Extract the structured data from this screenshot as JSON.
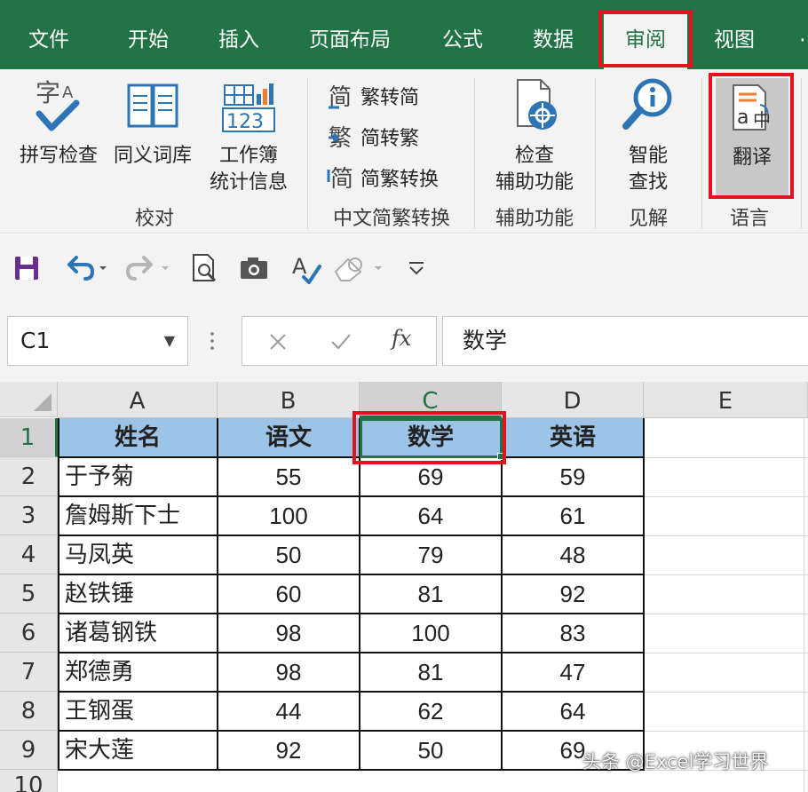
{
  "tabs": [
    {
      "label": "文件",
      "active": false
    },
    {
      "label": "开始",
      "active": false
    },
    {
      "label": "插入",
      "active": false
    },
    {
      "label": "页面布局",
      "active": false
    },
    {
      "label": "公式",
      "active": false
    },
    {
      "label": "数据",
      "active": false
    },
    {
      "label": "审阅",
      "active": true
    },
    {
      "label": "视图",
      "active": false
    }
  ],
  "ribbon": {
    "proofing": {
      "spell_check": "拼写检查",
      "thesaurus": "同义词库",
      "workbook_stats_line1": "工作簿",
      "workbook_stats_line2": "统计信息",
      "group_label": "校对"
    },
    "chinese_conversion": {
      "to_simplified": "繁转简",
      "to_traditional": "简转繁",
      "convert": "简繁转换",
      "group_label": "中文简繁转换"
    },
    "accessibility": {
      "check_line1": "检查",
      "check_line2": "辅助功能",
      "group_label": "辅助功能"
    },
    "insights": {
      "smart_lookup_line1": "智能",
      "smart_lookup_line2": "查找",
      "group_label": "见解"
    },
    "language": {
      "translate": "翻译",
      "group_label": "语言"
    }
  },
  "formula_bar": {
    "name_box": "C1",
    "formula": "数学",
    "fx_symbol": "fx"
  },
  "sheet": {
    "columns": [
      "A",
      "B",
      "C",
      "D",
      "E"
    ],
    "rows": [
      "1",
      "2",
      "3",
      "4",
      "5",
      "6",
      "7",
      "8",
      "9",
      "10"
    ],
    "header": [
      "姓名",
      "语文",
      "数学",
      "英语"
    ],
    "data": [
      [
        "于予菊",
        "55",
        "69",
        "59"
      ],
      [
        "詹姆斯下士",
        "100",
        "64",
        "61"
      ],
      [
        "马凤英",
        "50",
        "79",
        "48"
      ],
      [
        "赵铁锤",
        "60",
        "81",
        "92"
      ],
      [
        "诸葛钢铁",
        "98",
        "100",
        "83"
      ],
      [
        "郑德勇",
        "98",
        "81",
        "47"
      ],
      [
        "王钢蛋",
        "44",
        "62",
        "64"
      ],
      [
        "宋大莲",
        "92",
        "50",
        "69"
      ]
    ]
  },
  "watermark": "头条 @Excel学习世界",
  "colors": {
    "ribbon_green": "#217346",
    "header_fill": "#9dc3e6",
    "highlight_red": "#e0141e"
  }
}
